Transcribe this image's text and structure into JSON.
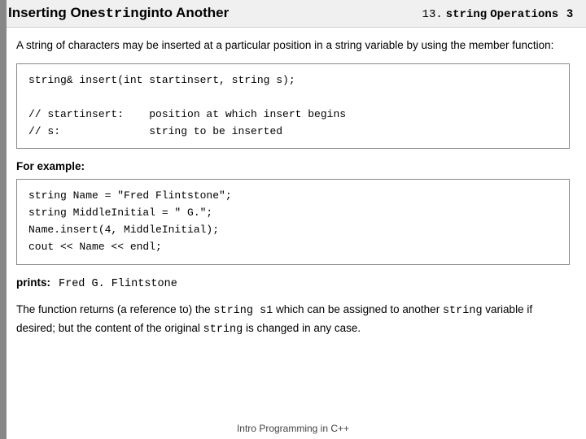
{
  "header": {
    "title_before": "Inserting One ",
    "title_code": "string",
    "title_after": " into Another",
    "section_number": "13.",
    "section_code": "string",
    "section_label": "Operations",
    "page_number": "3"
  },
  "intro": {
    "text": "A string of characters may be inserted at a particular position in a string variable by using the member function:"
  },
  "code_box_1": {
    "line1": "string& insert(int startinsert, string s);",
    "line2": "",
    "line3": "// startinsert:    position at which insert begins",
    "line4": "// s:              string to be inserted"
  },
  "for_example": {
    "label": "For example:"
  },
  "code_box_2": {
    "line1": "string Name = \"Fred Flintstone\";",
    "line2": "string MiddleInitial = \" G.\";",
    "line3": "Name.insert(4, MiddleInitial);",
    "line4": "cout << Name << endl;"
  },
  "prints": {
    "label": "prints:",
    "value": "Fred G. Flintstone"
  },
  "conclusion": {
    "part1": "The function returns (a reference to) the ",
    "code1": "string s1",
    "part2": " which can be assigned to another ",
    "code2": "string",
    "part3": " variable if desired; but the content of the original ",
    "code3": "string",
    "part4": " is changed in any case."
  },
  "footer": {
    "text": "Intro Programming in C++"
  }
}
